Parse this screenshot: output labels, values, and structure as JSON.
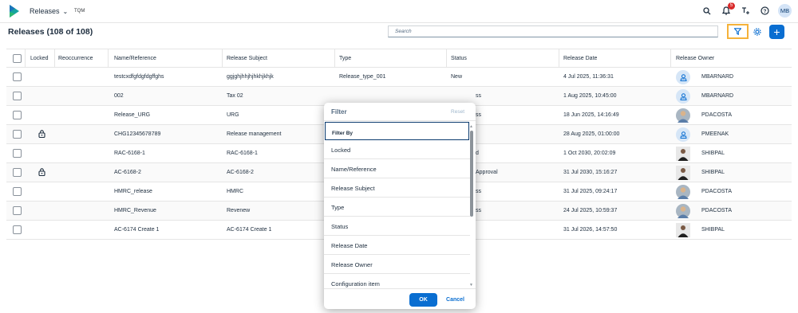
{
  "app": {
    "title": "Releases",
    "org": "TQM"
  },
  "shell": {
    "notification_count": "5",
    "user_initials": "MB"
  },
  "page": {
    "title": "Releases (108 of 108)"
  },
  "search": {
    "placeholder": "Search"
  },
  "table": {
    "headers": [
      "Locked",
      "Reoccurrence",
      "Name/Reference",
      "Release Subject",
      "Type",
      "Status",
      "Release Date",
      "Release Owner"
    ],
    "rows": [
      {
        "locked": false,
        "name": "testcxdfgfdgfdgffghs",
        "subject": "ggjghjhhjhjhkhjkhjk",
        "type": "Release_type_001",
        "status": "New",
        "date": "4 Jul 2025, 11:36:31",
        "owner": "MBARNARD",
        "avatar": "person"
      },
      {
        "locked": false,
        "name": "002",
        "subject": "Tax 02",
        "type": "",
        "status": "ss",
        "date": "1 Aug 2025, 10:45:00",
        "owner": "MBARNARD",
        "avatar": "person"
      },
      {
        "locked": false,
        "name": "Release_URG",
        "subject": "URG",
        "type": "",
        "status": "ss",
        "date": "18 Jun 2025, 14:16:49",
        "owner": "PDACOSTA",
        "avatar": "photo"
      },
      {
        "locked": true,
        "name": "CHG12345678789",
        "subject": "Release management",
        "type": "",
        "status": "",
        "date": "28 Aug 2025, 01:00:00",
        "owner": "PMEENAK",
        "avatar": "person"
      },
      {
        "locked": false,
        "name": "RAC-6168-1",
        "subject": "RAC-6168-1",
        "type": "",
        "status": "d",
        "date": "1 Oct 2030, 20:02:09",
        "owner": "SHIBPAL",
        "avatar": "dark"
      },
      {
        "locked": true,
        "name": "AC-6168-2",
        "subject": "AC-6168-2",
        "type": "",
        "status": "Approval",
        "date": "31 Jul 2030, 15:16:27",
        "owner": "SHIBPAL",
        "avatar": "dark"
      },
      {
        "locked": false,
        "name": "HMRC_release",
        "subject": "HMRC",
        "type": "",
        "status": "ss",
        "date": "31 Jul 2025, 09:24:17",
        "owner": "PDACOSTA",
        "avatar": "photo"
      },
      {
        "locked": false,
        "name": "HMRC_Revenue",
        "subject": "Revenew",
        "type": "",
        "status": "ss",
        "date": "24 Jul 2025, 10:59:37",
        "owner": "PDACOSTA",
        "avatar": "photo"
      },
      {
        "locked": false,
        "name": "AC-6174 Create 1",
        "subject": "AC-6174 Create 1",
        "type": "",
        "status": "",
        "date": "31 Jul 2026, 14:57:50",
        "owner": "SHIBPAL",
        "avatar": "dark"
      }
    ]
  },
  "dialog": {
    "title": "Filter",
    "reset": "Reset",
    "section": "Filter By",
    "items": [
      "Locked",
      "Name/Reference",
      "Release Subject",
      "Type",
      "Status",
      "Release Date",
      "Release Owner",
      "Configuration item"
    ],
    "ok": "OK",
    "cancel": "Cancel"
  },
  "colors": {
    "accent": "#0a6ed1",
    "highlight": "#f5b23a",
    "badge": "#d92b2b"
  }
}
